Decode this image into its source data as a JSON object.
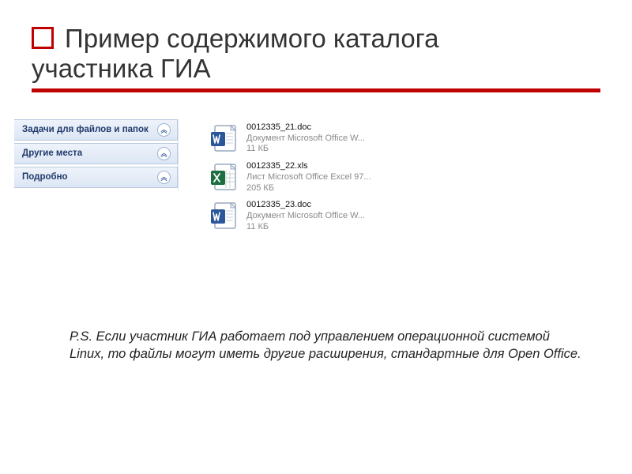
{
  "slide": {
    "title_line1": "Пример содержимого каталога",
    "title_line2": "участника ГИА"
  },
  "sidebar": {
    "tasks_label": "Задачи для файлов и папок",
    "places_label": "Другие места",
    "details_label": "Подробно"
  },
  "files": [
    {
      "name": "0012335_21.doc",
      "type": "Документ Microsoft Office W...",
      "size": "11 КБ",
      "icon": "word"
    },
    {
      "name": "0012335_22.xls",
      "type": "Лист Microsoft Office Excel 97...",
      "size": "205 КБ",
      "icon": "excel"
    },
    {
      "name": "0012335_23.doc",
      "type": "Документ Microsoft Office W...",
      "size": "11 КБ",
      "icon": "word"
    }
  ],
  "note": "P.S. Если участник ГИА работает под управлением операционной системой Linux, то файлы могут иметь другие расширения, стандартные для Open Office."
}
